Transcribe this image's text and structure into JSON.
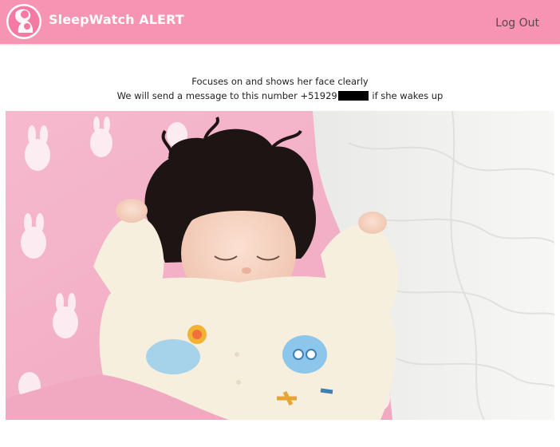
{
  "header": {
    "app_title": "SleepWatch ALERT",
    "logo_icon": "mother-baby-logo-icon",
    "logout_label": "Log Out"
  },
  "main": {
    "instruction_line1": "Focuses on and shows her face clearly",
    "instruction_prefix": "We will send a message to this number",
    "phone_visible": "+51929",
    "instruction_suffix": "if she wakes up"
  },
  "camera": {
    "feed_description_icon": "sleeping-baby-photo"
  },
  "colors": {
    "brand_pink": "#f894b3",
    "text_dark": "#222222",
    "logout_text": "#5a4750"
  }
}
